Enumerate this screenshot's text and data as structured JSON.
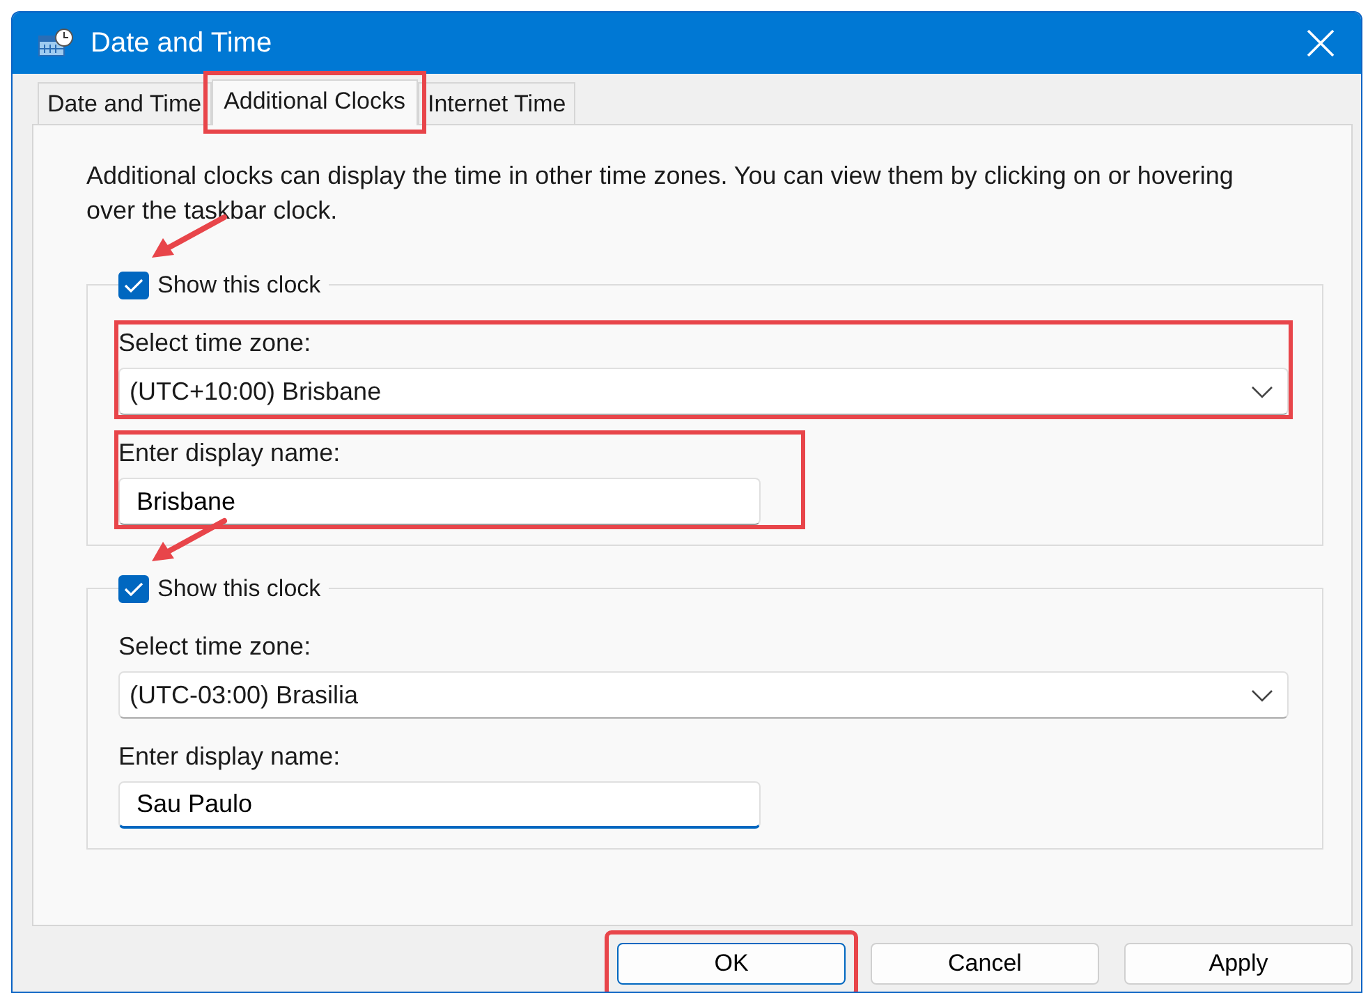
{
  "window": {
    "title": "Date and Time"
  },
  "tabs": [
    {
      "label": "Date and Time",
      "selected": false,
      "highlighted": false
    },
    {
      "label": "Additional Clocks",
      "selected": true,
      "highlighted": true
    },
    {
      "label": "Internet Time",
      "selected": false,
      "highlighted": false
    }
  ],
  "description": "Additional clocks can display the time in other time zones. You can view them by clicking on or hovering over the taskbar clock.",
  "clocks": [
    {
      "checkbox_label": "Show this clock",
      "checked": true,
      "arrow": true,
      "timezone_label": "Select time zone:",
      "timezone": "(UTC+10:00) Brisbane",
      "timezone_highlighted": true,
      "name_label": "Enter display name:",
      "name": "Brisbane",
      "name_highlighted": true,
      "focused": false
    },
    {
      "checkbox_label": "Show this clock",
      "checked": true,
      "arrow": true,
      "timezone_label": "Select time zone:",
      "timezone": "(UTC-03:00) Brasilia",
      "timezone_highlighted": false,
      "name_label": "Enter display name:",
      "name": "Sau Paulo",
      "name_highlighted": false,
      "focused": true
    }
  ],
  "buttons": [
    {
      "label": "OK",
      "default": true,
      "highlighted": true
    },
    {
      "label": "Cancel",
      "default": false,
      "highlighted": false
    },
    {
      "label": "Apply",
      "default": false,
      "highlighted": false
    }
  ]
}
